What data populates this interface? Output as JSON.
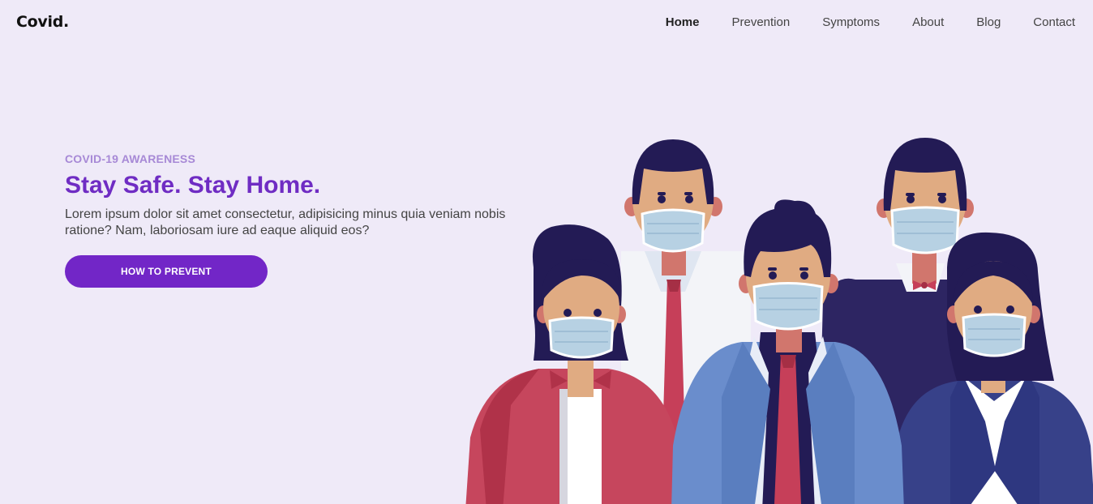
{
  "brand": "Covid.",
  "nav": {
    "items": [
      {
        "label": "Home",
        "active": true
      },
      {
        "label": "Prevention"
      },
      {
        "label": "Symptoms"
      },
      {
        "label": "About"
      },
      {
        "label": "Blog"
      },
      {
        "label": "Contact"
      }
    ]
  },
  "hero": {
    "eyebrow": "COVID-19 AWARENESS",
    "headline": "Stay Safe. Stay Home.",
    "lead": "Lorem ipsum dolor sit amet consectetur, adipisicing minus quia veniam nobis ratione? Nam, laboriosam iure ad eaque aliquid eos?",
    "cta_label": "HOW TO PREVENT"
  },
  "colors": {
    "background": "#efeaf8",
    "accent": "#7226c7",
    "eyebrow": "#a789d6"
  }
}
